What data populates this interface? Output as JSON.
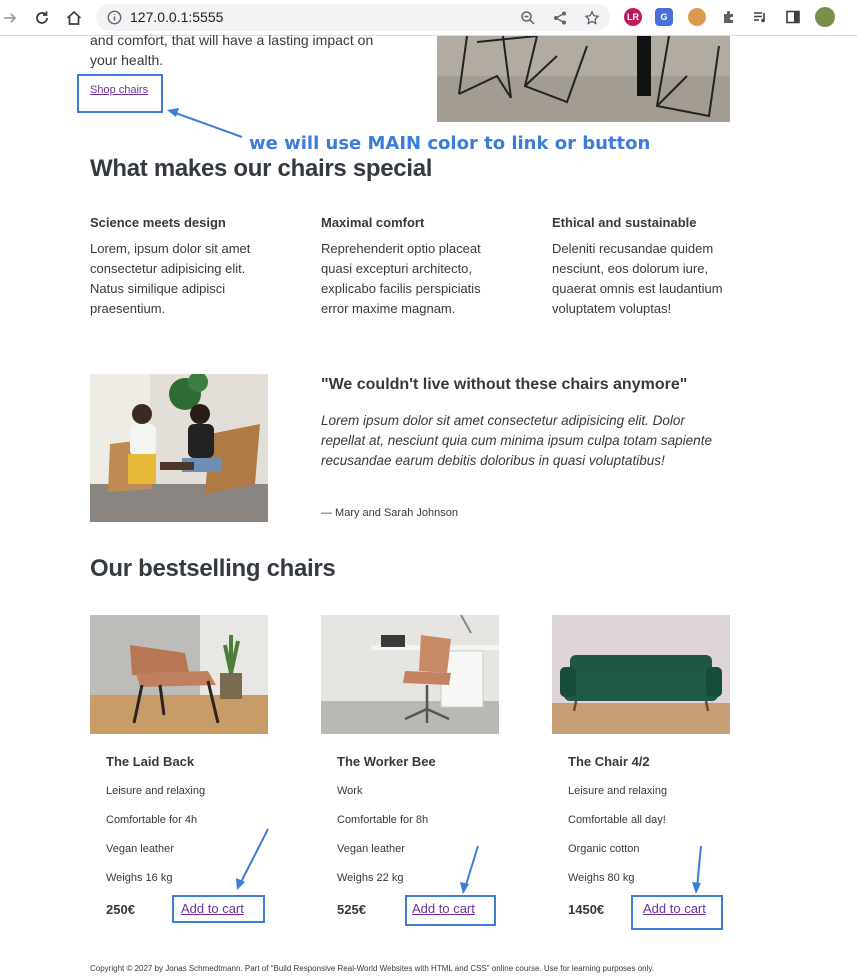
{
  "browser": {
    "url": "127.0.0.1:5555",
    "extensions": [
      "lr-extension-icon",
      "translate-extension-icon",
      "cookie-extension-icon",
      "puzzle-extensions-icon",
      "media-queue-icon",
      "side-panel-icon",
      "profile-avatar"
    ]
  },
  "intro": {
    "text": "and comfort, that will have a lasting impact on your health.",
    "shop_link": "Shop chairs"
  },
  "annotation": {
    "note": "we will use MAIN color to link or button",
    "color": "#3b7dd8"
  },
  "features_section": {
    "title": "What makes our chairs special",
    "items": [
      {
        "title": "Science meets design",
        "text": "Lorem, ipsum dolor sit amet consectetur adipisicing elit. Natus similique adipisci praesentium."
      },
      {
        "title": "Maximal comfort",
        "text": "Reprehenderit optio placeat quasi excepturi architecto, explicabo facilis perspiciatis error maxime magnam."
      },
      {
        "title": "Ethical and sustainable",
        "text": "Deleniti recusandae quidem nesciunt, eos dolorum iure, quaerat omnis est laudantium voluptatem voluptas!"
      }
    ]
  },
  "testimonial": {
    "quote": "\"We couldn't live without these chairs anymore\"",
    "body": "Lorem ipsum dolor sit amet consectetur adipisicing elit. Dolor repellat at, nesciunt quia cum minima ipsum culpa totam sapiente recusandae earum debitis doloribus in quasi voluptatibus!",
    "author": "— Mary and Sarah Johnson"
  },
  "products_section": {
    "title": "Our bestselling chairs",
    "products": [
      {
        "name": "The Laid Back",
        "attrs": [
          "Leisure and relaxing",
          "Comfortable for 4h",
          "Vegan leather",
          "Weighs 16 kg"
        ],
        "price": "250€",
        "cart": "Add to cart"
      },
      {
        "name": "The Worker Bee",
        "attrs": [
          "Work",
          "Comfortable for 8h",
          "Vegan leather",
          "Weighs 22 kg"
        ],
        "price": "525€",
        "cart": "Add to cart"
      },
      {
        "name": "The Chair 4/2",
        "attrs": [
          "Leisure and relaxing",
          "Comfortable all day!",
          "Organic cotton",
          "Weighs 80 kg"
        ],
        "price": "1450€",
        "cart": "Add to cart"
      }
    ]
  },
  "footer": {
    "text": "Copyright © 2027 by Jonas Schmedtmann. Part of \"Build Responsive Real-World Websites with HTML and CSS\" online course. Use for learning purposes only."
  },
  "colors": {
    "link": "#6f2f9f",
    "text": "#343a40",
    "annotation": "#3b7dd8"
  }
}
